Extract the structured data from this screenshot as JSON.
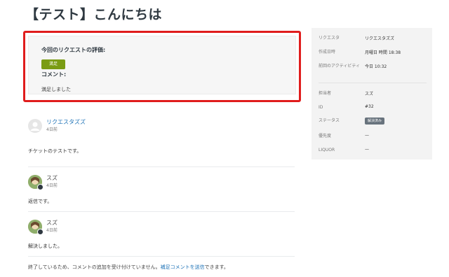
{
  "page": {
    "title": "【テスト】こんにちは"
  },
  "satisfaction": {
    "heading": "今回のリクエストの評価:",
    "rating_label": "満足",
    "comment_label": "コメント:",
    "comment_text": "満足しました"
  },
  "comments": [
    {
      "author": "リクエスタズズ",
      "time": "4日前",
      "body": "チケットのテストです。"
    },
    {
      "author": "スズ",
      "time": "4日前",
      "body": "返信です。"
    },
    {
      "author": "スズ",
      "time": "4日前",
      "body": "解決しました。"
    }
  ],
  "footer": {
    "text_before": "終了しているため、コメントの追加を受け付けていません。",
    "link": "補足コメントを送信",
    "text_after": "できます。"
  },
  "sidebar": {
    "requester_label": "リクエスタ",
    "requester_value": "リクエスタズズ",
    "created_label": "作成日時",
    "created_value": "月曜日 時間 18:38",
    "last_activity_label": "前回のアクティビティ",
    "last_activity_value": "今日 10:32",
    "assignee_label": "担当者",
    "assignee_value": "スズ",
    "id_label": "ID",
    "id_value": "#32",
    "status_label": "ステータス",
    "status_value": "解決済み",
    "priority_label": "優先度",
    "priority_value": "—",
    "liquor_label": "LIQUOR",
    "liquor_value": "—"
  },
  "colors": {
    "highlight": "#e01c1c",
    "badge": "#7a9c14",
    "link": "#1f73b7"
  }
}
